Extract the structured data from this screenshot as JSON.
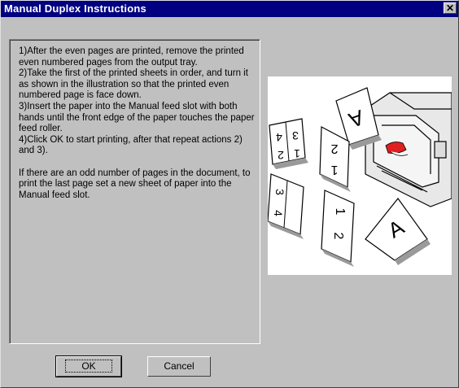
{
  "window": {
    "title": "Manual Duplex Instructions",
    "close_glyph": "✕"
  },
  "instructions": {
    "text": "1)After the even pages are printed, remove the printed even numbered pages from the output tray.\n2)Take the first of the printed sheets in order, and turn it as shown in the illustration so that the printed even numbered page is face down.\n3)Insert the paper into the Manual feed slot with both hands until the front edge of the paper touches the paper feed roller.\n4)Click OK to start printing, after that repeat actions 2) and 3).\n\n If there are an odd number of pages in the document, to print the last page set a new sheet of paper into the Manual feed slot."
  },
  "illustration": {
    "sheet_labels": [
      "A",
      "4",
      "3",
      "2",
      "1",
      "2",
      "1",
      "3",
      "4",
      "1",
      "2",
      "A"
    ],
    "accent_color": "#e02020"
  },
  "buttons": {
    "ok_label": "OK",
    "cancel_label": "Cancel"
  }
}
